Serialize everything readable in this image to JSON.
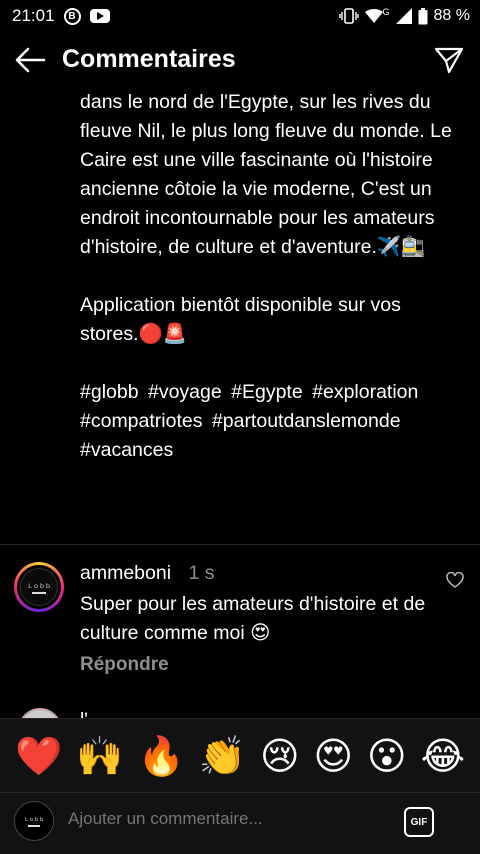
{
  "status_bar": {
    "time": "21:01",
    "b_icon_label": "B",
    "battery_percent": "88 %",
    "network_label": "G"
  },
  "header": {
    "title": "Commentaires"
  },
  "caption": {
    "paragraph1": "dans le nord de l'Egypte, sur les rives du fleuve Nil, le plus long fleuve du monde. Le Caire est une ville fascinante où l'histoire ancienne côtoie la vie moderne, C'est un endroit incontournable pour les amateurs d'histoire, de culture et d'aventure.✈️🚉",
    "paragraph2": "Application bientôt disponible sur vos stores.🔴🚨",
    "hashtags": [
      "#globb",
      "#voyage",
      "#Egypte",
      "#exploration",
      "#compatriotes",
      "#partoutdanslemonde",
      "#vacances"
    ]
  },
  "comment": {
    "username": "ammeboni",
    "time": "1 s",
    "text": "Super pour les amateurs d'histoire et de culture comme moi 😍",
    "reply_label": "Répondre",
    "avatar_text": "Ｌｏｂｂ"
  },
  "next_comment": {
    "partial_text": "l'"
  },
  "emoji_bar": {
    "emojis": [
      "❤️",
      "🙌",
      "🔥",
      "👏",
      "😢",
      "😍",
      "😮",
      "😂"
    ]
  },
  "input_bar": {
    "placeholder": "Ajouter un commentaire...",
    "gif_label": "GIF"
  },
  "colors": {
    "background": "#000000",
    "muted_text": "#8e8e8e",
    "bar_background": "#121212"
  }
}
